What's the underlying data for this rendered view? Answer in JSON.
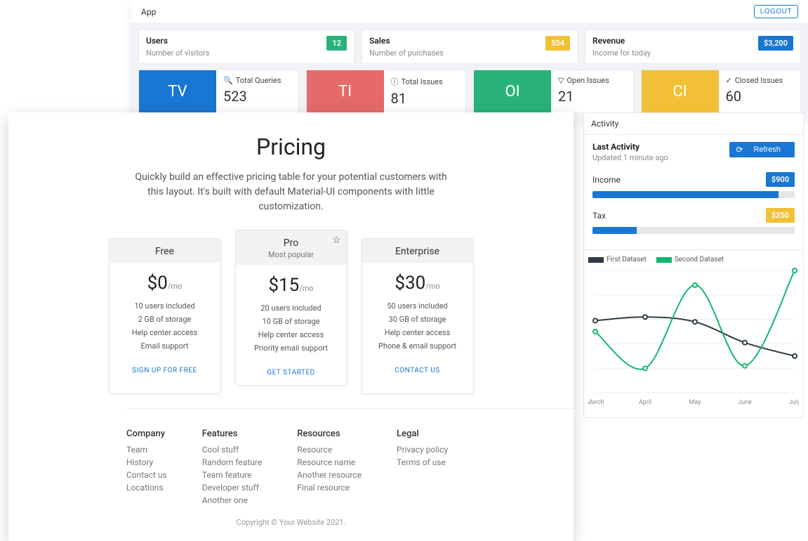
{
  "header": {
    "app": "App",
    "logout": "LOGOUT"
  },
  "metrics": [
    {
      "title": "Users",
      "sub": "Number of visitors",
      "value": "12",
      "color": "green"
    },
    {
      "title": "Sales",
      "sub": "Number of purchases",
      "value": "534",
      "color": "amber"
    },
    {
      "title": "Revenue",
      "sub": "Income for today",
      "value": "$3,200",
      "color": "blue"
    }
  ],
  "categories": [
    {
      "abbr": "TV",
      "label": "Total Queries",
      "value": "523",
      "tile": "blue",
      "icon": "search"
    },
    {
      "abbr": "TI",
      "label": "Total Issues",
      "value": "81",
      "tile": "red",
      "icon": "info"
    },
    {
      "abbr": "OI",
      "label": "Open Issues",
      "value": "21",
      "tile": "green",
      "icon": "filter"
    },
    {
      "abbr": "CI",
      "label": "Closed Issues",
      "value": "60",
      "tile": "amber",
      "icon": "check"
    }
  ],
  "activity": {
    "heading": "Activity",
    "last": "Last Activity",
    "updated": "Updated 1 minute ago",
    "refresh": "Refresh",
    "items": [
      {
        "label": "Income",
        "amount": "$900",
        "amtColor": "blue",
        "pct": 92
      },
      {
        "label": "Tax",
        "amount": "$250",
        "amtColor": "amber",
        "pct": 22
      }
    ]
  },
  "chart_data": {
    "type": "line",
    "categories": [
      "March",
      "April",
      "May",
      "June",
      "July"
    ],
    "series": [
      {
        "name": "First Dataset",
        "color": "#2f3b44",
        "values": [
          59,
          62,
          58,
          41,
          30
        ]
      },
      {
        "name": "Second Dataset",
        "color": "#12b66f",
        "values": [
          50,
          20,
          88,
          22,
          100
        ]
      }
    ],
    "xlabel": "",
    "ylabel": "",
    "ylim": [
      0,
      100
    ]
  },
  "pricing": {
    "title": "Pricing",
    "subtitle": "Quickly build an effective pricing table for your potential customers with this layout. It's built with default Material-UI components with little customization.",
    "tiers": [
      {
        "name": "Free",
        "price": "$0",
        "per": "/mo",
        "features": [
          "10 users included",
          "2 GB of storage",
          "Help center access",
          "Email support"
        ],
        "cta": "SIGN UP FOR FREE"
      },
      {
        "name": "Pro",
        "tag": "Most popular",
        "price": "$15",
        "per": "/mo",
        "features": [
          "20 users included",
          "10 GB of storage",
          "Help center access",
          "Priority email support"
        ],
        "cta": "GET STARTED",
        "starred": true
      },
      {
        "name": "Enterprise",
        "price": "$30",
        "per": "/mo",
        "features": [
          "50 users included",
          "30 GB of storage",
          "Help center access",
          "Phone & email support"
        ],
        "cta": "CONTACT US"
      }
    ],
    "footer": {
      "cols": [
        {
          "h": "Company",
          "links": [
            "Team",
            "History",
            "Contact us",
            "Locations"
          ]
        },
        {
          "h": "Features",
          "links": [
            "Cool stuff",
            "Random feature",
            "Team feature",
            "Developer stuff",
            "Another one"
          ]
        },
        {
          "h": "Resources",
          "links": [
            "Resource",
            "Resource name",
            "Another resource",
            "Final resource"
          ]
        },
        {
          "h": "Legal",
          "links": [
            "Privacy policy",
            "Terms of use"
          ]
        }
      ],
      "copyright": "Copyright © Your Website 2021."
    }
  }
}
